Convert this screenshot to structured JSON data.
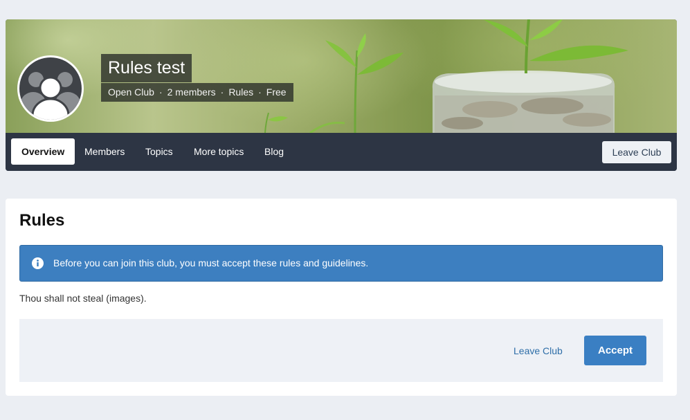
{
  "club": {
    "title": "Rules test",
    "type": "Open Club",
    "members": "2 members",
    "rules_link": "Rules",
    "price": "Free",
    "separator": "·"
  },
  "nav": {
    "tabs": [
      {
        "label": "Overview",
        "active": true
      },
      {
        "label": "Members",
        "active": false
      },
      {
        "label": "Topics",
        "active": false
      },
      {
        "label": "More topics",
        "active": false
      },
      {
        "label": "Blog",
        "active": false
      }
    ],
    "leave_label": "Leave Club"
  },
  "rules_panel": {
    "heading": "Rules",
    "notice": "Before you can join this club, you must accept these rules and guidelines.",
    "rule_text": "Thou shall not steal (images).",
    "leave_label": "Leave Club",
    "accept_label": "Accept"
  },
  "icons": {
    "avatar": "group-avatar-icon",
    "notice": "info-icon"
  },
  "colors": {
    "nav_bg": "#2d3544",
    "accent": "#3a7fc3",
    "notice_bg": "#3d7fc0",
    "page_bg": "#ebeef3"
  }
}
